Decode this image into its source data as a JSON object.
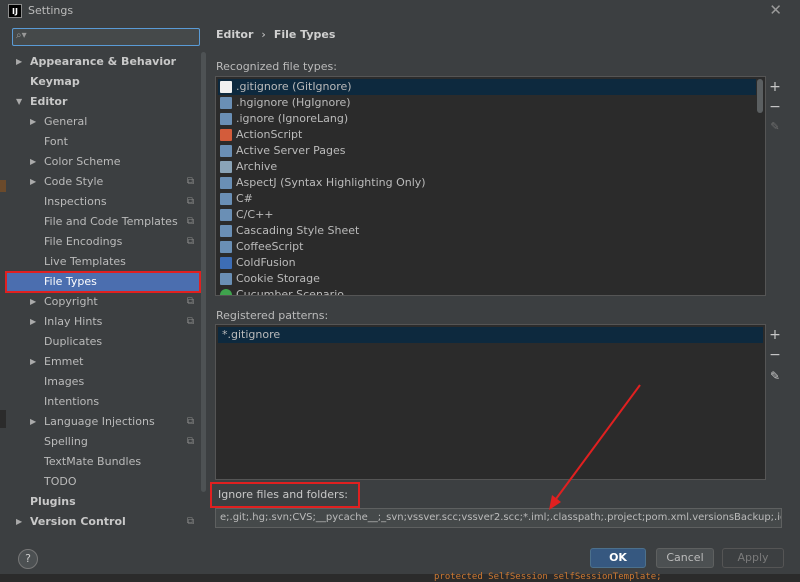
{
  "window": {
    "title": "Settings",
    "logo_text": "IJ"
  },
  "search": {
    "placeholder": "Q▾",
    "value": ""
  },
  "sidebar": {
    "items": [
      {
        "label": "Appearance & Behavior",
        "level": 0,
        "arrow": "▶",
        "bold": true,
        "copy": false
      },
      {
        "label": "Keymap",
        "level": 0,
        "arrow": "",
        "bold": true,
        "copy": false
      },
      {
        "label": "Editor",
        "level": 0,
        "arrow": "▼",
        "bold": true,
        "copy": false
      },
      {
        "label": "General",
        "level": 1,
        "arrow": "▶",
        "bold": false,
        "copy": false
      },
      {
        "label": "Font",
        "level": 1,
        "arrow": "",
        "bold": false,
        "copy": false
      },
      {
        "label": "Color Scheme",
        "level": 1,
        "arrow": "▶",
        "bold": false,
        "copy": false
      },
      {
        "label": "Code Style",
        "level": 1,
        "arrow": "▶",
        "bold": false,
        "copy": true
      },
      {
        "label": "Inspections",
        "level": 1,
        "arrow": "",
        "bold": false,
        "copy": true
      },
      {
        "label": "File and Code Templates",
        "level": 1,
        "arrow": "",
        "bold": false,
        "copy": true
      },
      {
        "label": "File Encodings",
        "level": 1,
        "arrow": "",
        "bold": false,
        "copy": true
      },
      {
        "label": "Live Templates",
        "level": 1,
        "arrow": "",
        "bold": false,
        "copy": false
      },
      {
        "label": "File Types",
        "level": 1,
        "arrow": "",
        "bold": false,
        "copy": false,
        "selected": true
      },
      {
        "label": "Copyright",
        "level": 1,
        "arrow": "▶",
        "bold": false,
        "copy": true
      },
      {
        "label": "Inlay Hints",
        "level": 1,
        "arrow": "▶",
        "bold": false,
        "copy": true
      },
      {
        "label": "Duplicates",
        "level": 1,
        "arrow": "",
        "bold": false,
        "copy": false
      },
      {
        "label": "Emmet",
        "level": 1,
        "arrow": "▶",
        "bold": false,
        "copy": false
      },
      {
        "label": "Images",
        "level": 1,
        "arrow": "",
        "bold": false,
        "copy": false
      },
      {
        "label": "Intentions",
        "level": 1,
        "arrow": "",
        "bold": false,
        "copy": false
      },
      {
        "label": "Language Injections",
        "level": 1,
        "arrow": "▶",
        "bold": false,
        "copy": true
      },
      {
        "label": "Spelling",
        "level": 1,
        "arrow": "",
        "bold": false,
        "copy": true
      },
      {
        "label": "TextMate Bundles",
        "level": 1,
        "arrow": "",
        "bold": false,
        "copy": false
      },
      {
        "label": "TODO",
        "level": 1,
        "arrow": "",
        "bold": false,
        "copy": false
      },
      {
        "label": "Plugins",
        "level": 0,
        "arrow": "",
        "bold": true,
        "copy": false
      },
      {
        "label": "Version Control",
        "level": 0,
        "arrow": "▶",
        "bold": true,
        "copy": true
      }
    ]
  },
  "breadcrumb": {
    "part1": "Editor",
    "sep": "›",
    "part2": "File Types"
  },
  "recognized": {
    "label": "Recognized file types:",
    "items": [
      {
        "label": ".gitignore (GitIgnore)",
        "icon": "gitignore-icon",
        "color": "#f0f0f0",
        "selected": true
      },
      {
        "label": ".hgignore (HgIgnore)",
        "icon": "hgignore-icon",
        "color": "#6a8fb5"
      },
      {
        "label": ".ignore (IgnoreLang)",
        "icon": "ignore-icon",
        "color": "#6a8fb5"
      },
      {
        "label": "ActionScript",
        "icon": "actionscript-icon",
        "color": "#d35c3b"
      },
      {
        "label": "Active Server Pages",
        "icon": "asp-icon",
        "color": "#6a8fb5"
      },
      {
        "label": "Archive",
        "icon": "archive-icon",
        "color": "#8aa4b8"
      },
      {
        "label": "AspectJ (Syntax Highlighting Only)",
        "icon": "aspectj-icon",
        "color": "#6a8fb5"
      },
      {
        "label": "C#",
        "icon": "csharp-icon",
        "color": "#6a8fb5"
      },
      {
        "label": "C/C++",
        "icon": "cpp-icon",
        "color": "#6a8fb5"
      },
      {
        "label": "Cascading Style Sheet",
        "icon": "css-icon",
        "color": "#6a8fb5"
      },
      {
        "label": "CoffeeScript",
        "icon": "coffeescript-icon",
        "color": "#6a8fb5"
      },
      {
        "label": "ColdFusion",
        "icon": "coldfusion-icon",
        "color": "#3d6db5"
      },
      {
        "label": "Cookie Storage",
        "icon": "cookie-icon",
        "color": "#6a8fb5"
      },
      {
        "label": "Cucumber Scenario",
        "icon": "cucumber-icon",
        "color": "#3fa34d"
      }
    ]
  },
  "registered": {
    "label": "Registered patterns:",
    "items": [
      "*.gitignore"
    ]
  },
  "ignore": {
    "label": "Ignore files and folders:",
    "value": "e;.git;.hg;.svn;CVS;__pycache__;_svn;vssver.scc;vssver2.scc;*.iml;.classpath;.project;pom.xml.versionsBackup;.idea;.settings;"
  },
  "buttons": {
    "help": "?",
    "ok": "OK",
    "cancel": "Cancel",
    "apply": "Apply"
  },
  "tools": {
    "add": "+",
    "remove": "−",
    "edit": "✎"
  },
  "background_code": "protected SelfSession selfSessionTemplate;",
  "colors": {
    "selection": "#4b6eaf",
    "highlight_box": "#e02020",
    "ok_button": "#365880"
  }
}
